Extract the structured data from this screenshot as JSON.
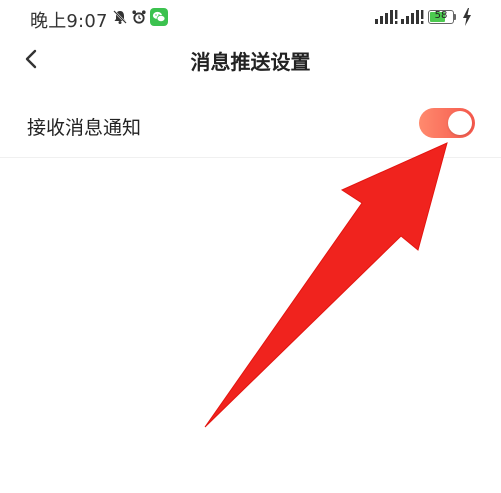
{
  "status_bar": {
    "time": "晚上9:07",
    "battery_level": "58",
    "icons": [
      "mute-bell-icon",
      "alarm-icon",
      "wechat-icon",
      "signal-icon",
      "signal-icon",
      "battery-icon",
      "charging-icon"
    ]
  },
  "header": {
    "back_icon": "chevron-left-icon",
    "title": "消息推送设置"
  },
  "settings": {
    "receive_notifications": {
      "label": "接收消息通知",
      "enabled": true
    }
  },
  "colors": {
    "toggle_on": "#f5584c",
    "toggle_on_light": "#ff8a6e",
    "arrow": "#f0231e",
    "wechat_green": "#3cc24f"
  }
}
